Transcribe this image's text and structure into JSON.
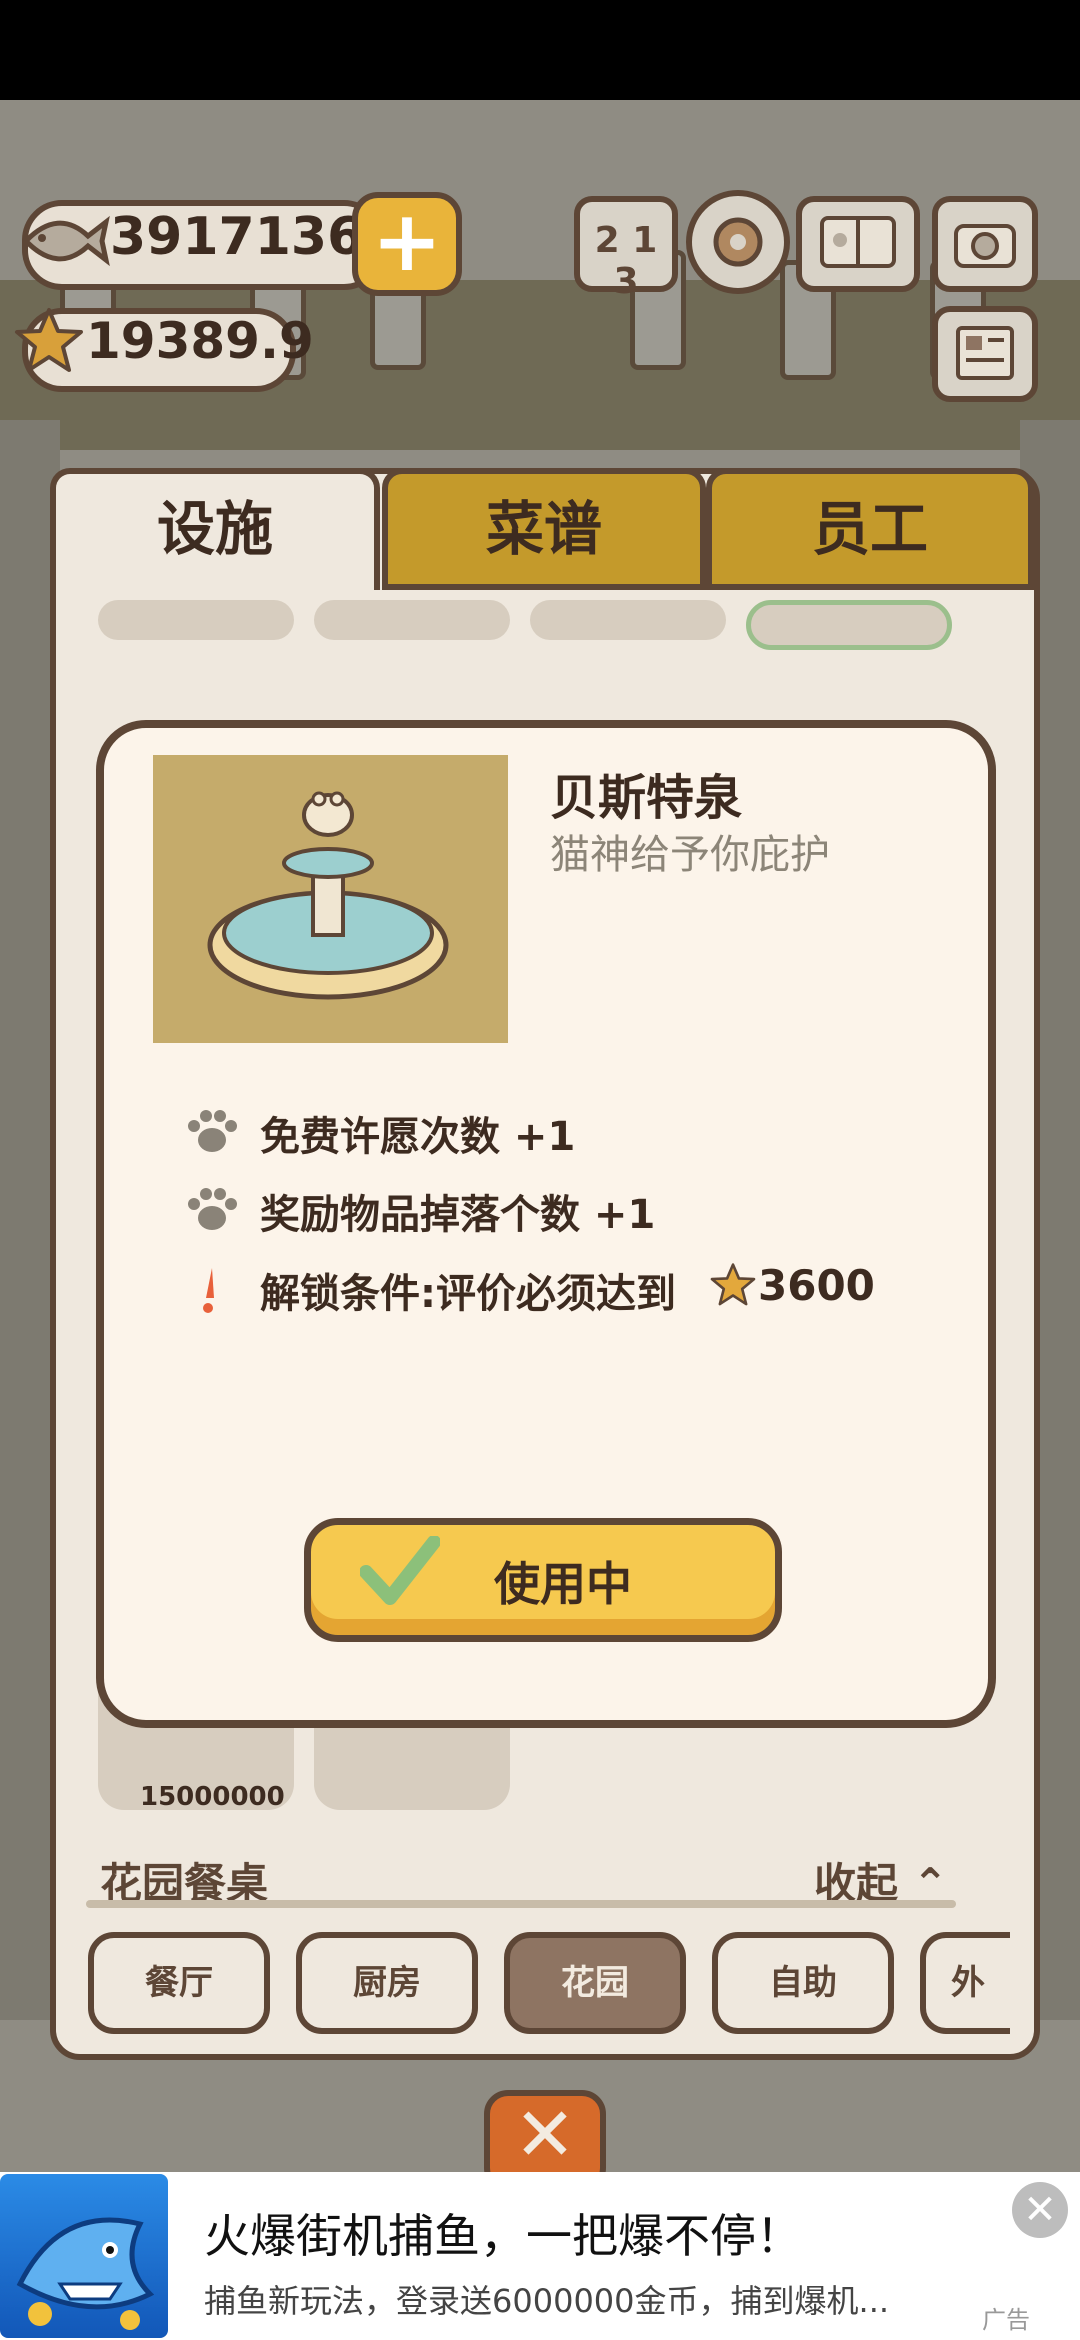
{
  "hud": {
    "fish_count": "3917136",
    "star_rating": "19389.9",
    "plus_label": "+",
    "rank_glyph": "2 1 3"
  },
  "tabs": [
    {
      "label": "设施",
      "active": true
    },
    {
      "label": "菜谱",
      "active": false
    },
    {
      "label": "员工",
      "active": false
    }
  ],
  "item_price": "15000000",
  "section": {
    "title": "花园餐桌",
    "collapse": "收起"
  },
  "categories": [
    {
      "label": "餐厅",
      "active": false
    },
    {
      "label": "厨房",
      "active": false
    },
    {
      "label": "花园",
      "active": true
    },
    {
      "label": "自助",
      "active": false
    },
    {
      "label": "外",
      "active": false
    }
  ],
  "modal": {
    "name": "贝斯特泉",
    "description": "猫神给予你庇护",
    "features": [
      {
        "icon": "paw-icon",
        "text": "免费许愿次数 +1"
      },
      {
        "icon": "paw-icon",
        "text": "奖励物品掉落个数 +1"
      },
      {
        "icon": "exclamation-icon",
        "text": "解锁条件:评价必须达到"
      }
    ],
    "unlock_value": "3600",
    "button_label": "使用中"
  },
  "close_glyph": "✕",
  "ad": {
    "title": "火爆街机捕鱼，一把爆不停！",
    "subtitle": "捕鱼新玩法，登录送6000000金币，捕到爆机...",
    "mark": "广告",
    "close_glyph": "✕"
  },
  "colors": {
    "outline": "#5d4636",
    "tab_inactive": "#c49a2b",
    "button_yellow": "#f6c94f",
    "accent_orange": "#d66a2a"
  }
}
